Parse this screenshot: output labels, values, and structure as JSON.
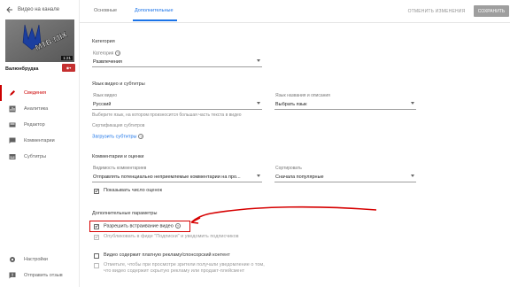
{
  "sidebar": {
    "back_title": "Видео на канале",
    "thumbnail": {
      "duration": "1:21",
      "logo_text": "MTB"
    },
    "channel_name": "Валюнбрудка",
    "visibility_color": "#c53030",
    "nav": [
      {
        "label": "Сведения",
        "icon": "pencil-icon",
        "active": true
      },
      {
        "label": "Аналитика",
        "icon": "analytics-icon",
        "active": false
      },
      {
        "label": "Редактор",
        "icon": "editor-icon",
        "active": false
      },
      {
        "label": "Комментарии",
        "icon": "comments-icon",
        "active": false
      },
      {
        "label": "Субтитры",
        "icon": "subtitles-icon",
        "active": false
      }
    ],
    "bottom_nav": [
      {
        "label": "Настройки",
        "icon": "gear-icon"
      },
      {
        "label": "Отправить отзыв",
        "icon": "feedback-icon"
      }
    ]
  },
  "topbar": {
    "tabs": [
      {
        "label": "Основные",
        "active": false
      },
      {
        "label": "Дополнительные",
        "active": true
      }
    ],
    "discard_label": "ОТМЕНИТЬ ИЗМЕНЕНИЯ",
    "save_label": "СОХРАНИТЬ",
    "accent_color": "#1a73e8"
  },
  "category": {
    "section_title": "Категория",
    "field_label": "Категория",
    "field_value": "Развлечения"
  },
  "language": {
    "section_title": "Язык видео и субтитры",
    "video_lang_label": "Язык видео",
    "video_lang_value": "Русский",
    "hint": "Выберите язык, на котором произносится большая часть текста в видео",
    "captions_cert": "Сертификация субтитров",
    "subs_link": "Загрузить субтитры",
    "title_lang_label": "Язык названия и описания",
    "title_lang_value": "Выбрать язык"
  },
  "comments": {
    "section_title": "Комментарии и оценки",
    "visibility_label": "Видимость комментариев",
    "visibility_value": "Отправлять потенциально неприемлемые комментарии на про...",
    "sort_label": "Сортировать",
    "sort_value": "Сначала популярные",
    "show_likes_label": "Показывать число оценок"
  },
  "extra": {
    "section_title": "Дополнительные параметры",
    "allow_embed": "Разрешить встраивание видео",
    "subscribers_feed": "Опубликовать в фиде \"Подписки\" и уведомить подписчиков",
    "age_restriction": "Видео содержит платную рекламу/спонсорский контент",
    "paid_promo": "Отметьте, чтобы при просмотре зрители получали уведомление о том,",
    "paid_promo_2": "что видео содержит скрытую рекламу или продакт-плейсмент"
  },
  "annotation_color": "#d60000"
}
